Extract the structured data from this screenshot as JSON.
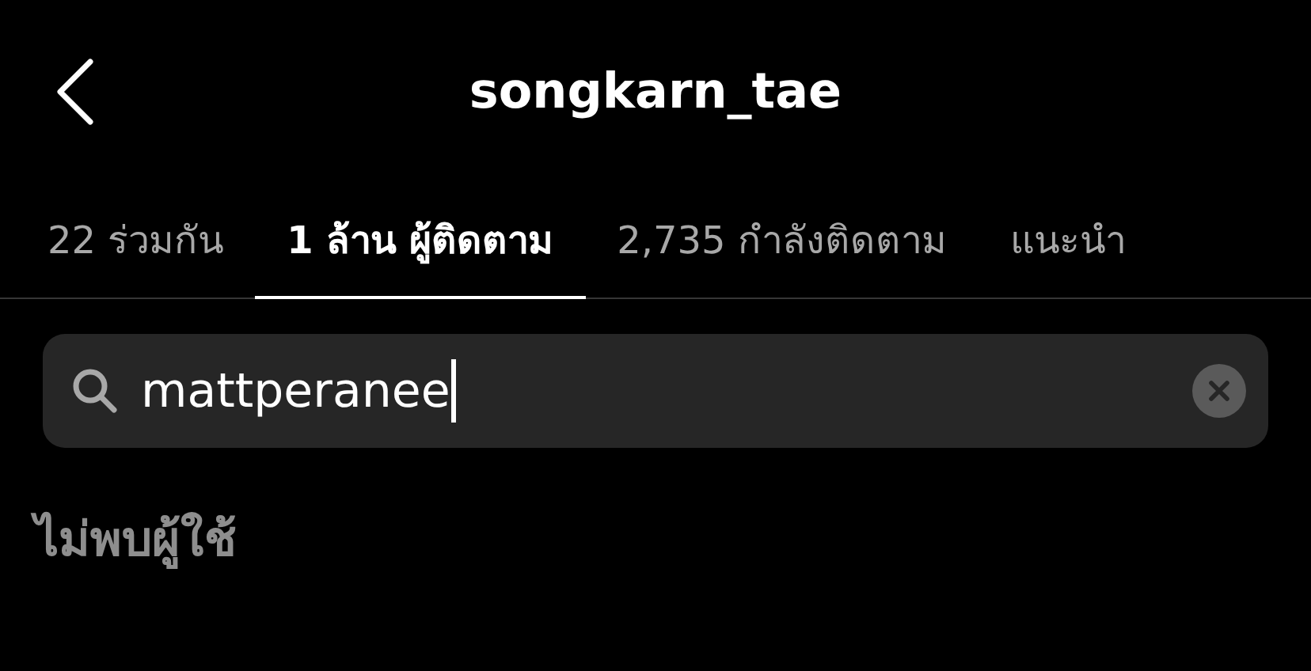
{
  "header": {
    "title": "songkarn_tae"
  },
  "tabs": [
    {
      "label": "22 ร่วมกัน",
      "selected": false
    },
    {
      "label": "1 ล้าน ผู้ติดตาม",
      "selected": true
    },
    {
      "label": "2,735 กำลังติดตาม",
      "selected": false
    },
    {
      "label": "แนะนำ",
      "selected": false
    }
  ],
  "search": {
    "value": "mattperanee"
  },
  "message": "ไม่พบผู้ใช้"
}
